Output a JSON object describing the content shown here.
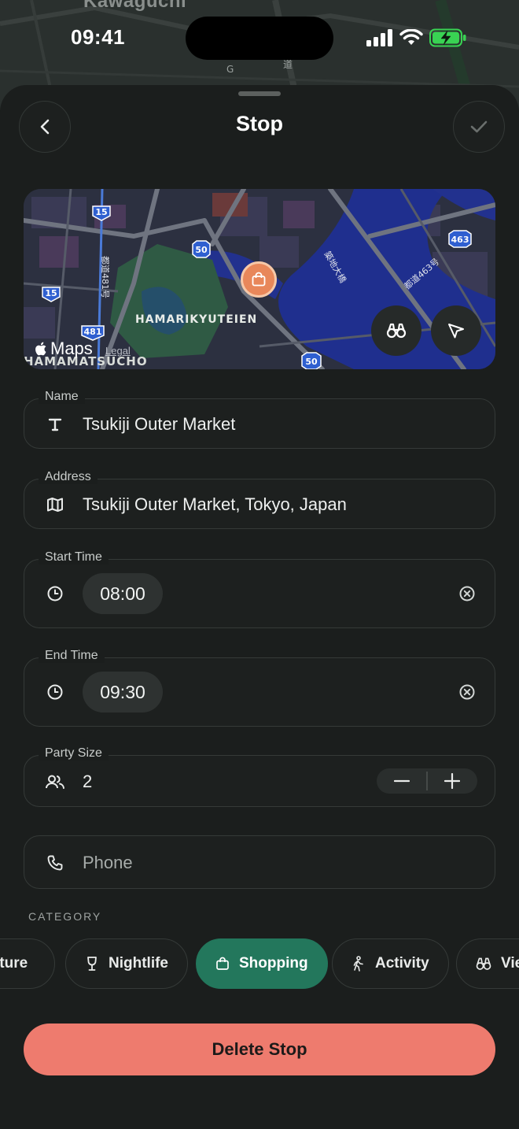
{
  "background": {
    "city_label": "Kawaguchi"
  },
  "status_bar": {
    "time": "09:41",
    "icons": [
      "signal-icon",
      "wifi-icon",
      "battery-charging-icon"
    ]
  },
  "header": {
    "title": "Stop",
    "back_icon": "chevron-left-icon",
    "done_icon": "checkmark-icon"
  },
  "map": {
    "provider": "Maps",
    "legal": "Legal",
    "park_label": "HAMARIKYUTEIEN",
    "ward_label": "HAMAMATSUCHO",
    "route_shields": [
      "15",
      "15",
      "50",
      "481",
      "463",
      "50"
    ],
    "route_labels": [
      "都道463号",
      "都道481号",
      "築地大橋"
    ],
    "pin_icon": "shopping-bag-icon",
    "buttons": [
      "binoculars-icon",
      "location-arrow-icon"
    ]
  },
  "form": {
    "name": {
      "label": "Name",
      "value": "Tsukiji Outer Market",
      "icon": "text-icon"
    },
    "address": {
      "label": "Address",
      "value": "Tsukiji Outer Market, Tokyo, Japan",
      "icon": "map-icon"
    },
    "start_time": {
      "label": "Start Time",
      "value": "08:00",
      "icon": "clock-icon"
    },
    "end_time": {
      "label": "End Time",
      "value": "09:30",
      "icon": "clock-icon"
    },
    "party_size": {
      "label": "Party Size",
      "value": "2",
      "icon": "people-icon"
    },
    "phone": {
      "placeholder": "Phone",
      "icon": "phone-icon"
    }
  },
  "category": {
    "label": "CATEGORY",
    "chips": [
      {
        "label": "Nature",
        "icon": "leaf-icon",
        "active": false
      },
      {
        "label": "Nightlife",
        "icon": "wine-glass-icon",
        "active": false
      },
      {
        "label": "Shopping",
        "icon": "shopping-bag-icon",
        "active": true
      },
      {
        "label": "Activity",
        "icon": "hiking-icon",
        "active": false
      },
      {
        "label": "View",
        "icon": "binoculars-icon",
        "active": false
      }
    ]
  },
  "actions": {
    "delete_label": "Delete Stop"
  },
  "colors": {
    "accent_green": "#23775c",
    "delete_red": "#ee7b6e",
    "pin_orange": "#e8875a",
    "battery_green": "#39d353"
  }
}
